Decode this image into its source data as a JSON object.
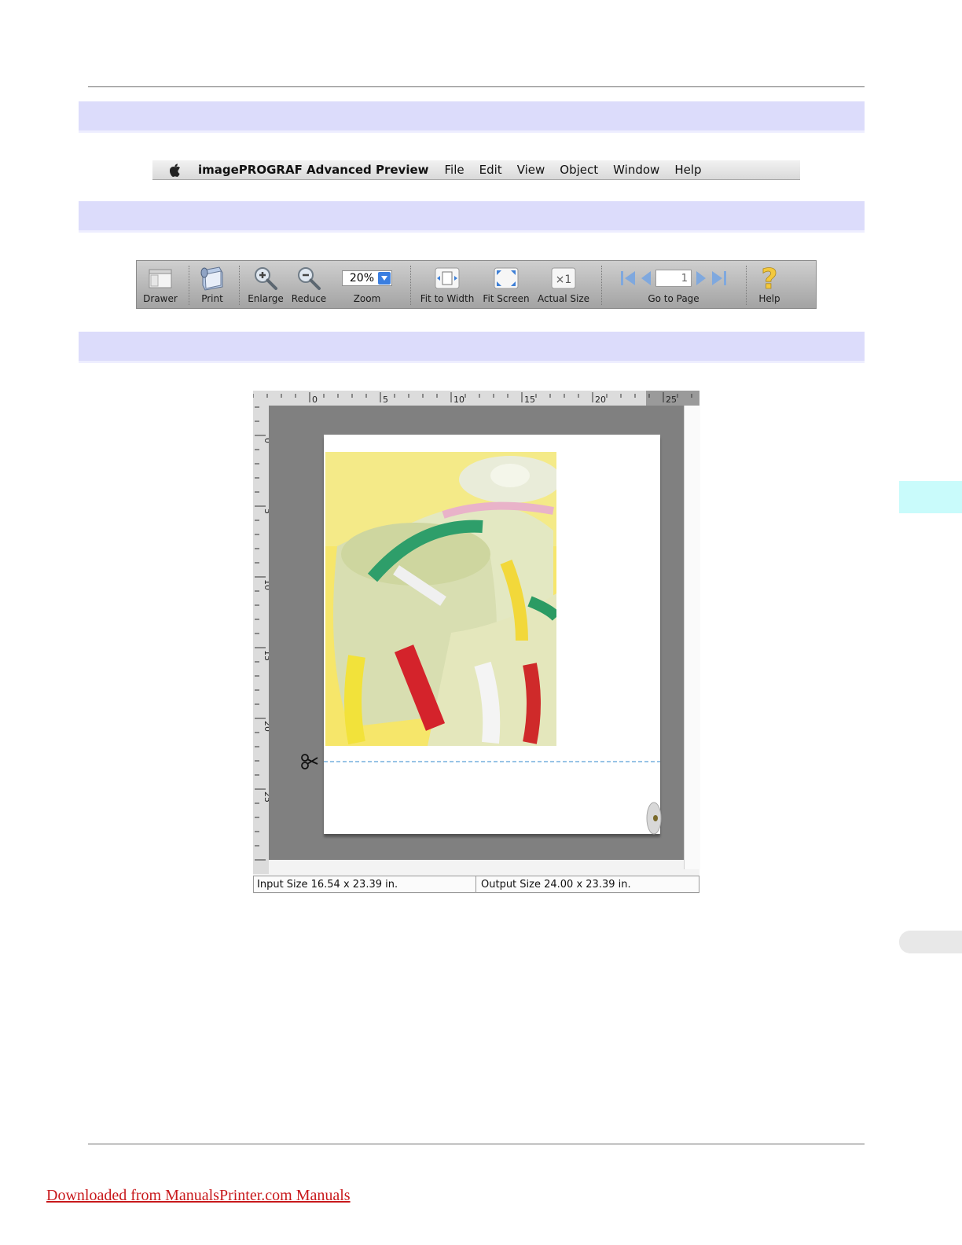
{
  "menubar": {
    "app_name": "imagePROGRAF Advanced Preview",
    "items": [
      "File",
      "Edit",
      "View",
      "Object",
      "Window",
      "Help"
    ]
  },
  "toolbar": {
    "drawer": "Drawer",
    "print": "Print",
    "enlarge": "Enlarge",
    "reduce": "Reduce",
    "zoom_value": "20%",
    "zoom": "Zoom",
    "fit_to_width": "Fit to Width",
    "fit_screen": "Fit Screen",
    "actual_size": "Actual Size",
    "page_number": "1",
    "go_to_page": "Go to Page",
    "help": "Help"
  },
  "preview": {
    "ruler_top_labels": [
      "0",
      "5",
      "10",
      "15",
      "20",
      "25"
    ],
    "ruler_left_labels": [
      "0",
      "5",
      "10",
      "15",
      "20",
      "25"
    ],
    "input_size": "Input Size 16.54 x 23.39 in.",
    "output_size": "Output Size 24.00 x 23.39 in."
  },
  "footer": {
    "link": "Downloaded from ManualsPrinter.com Manuals"
  },
  "colors": {
    "band": "#dcdcfb",
    "side_tab": "#c9fbfb",
    "link": "#c8191c",
    "canvas": "#808080"
  }
}
